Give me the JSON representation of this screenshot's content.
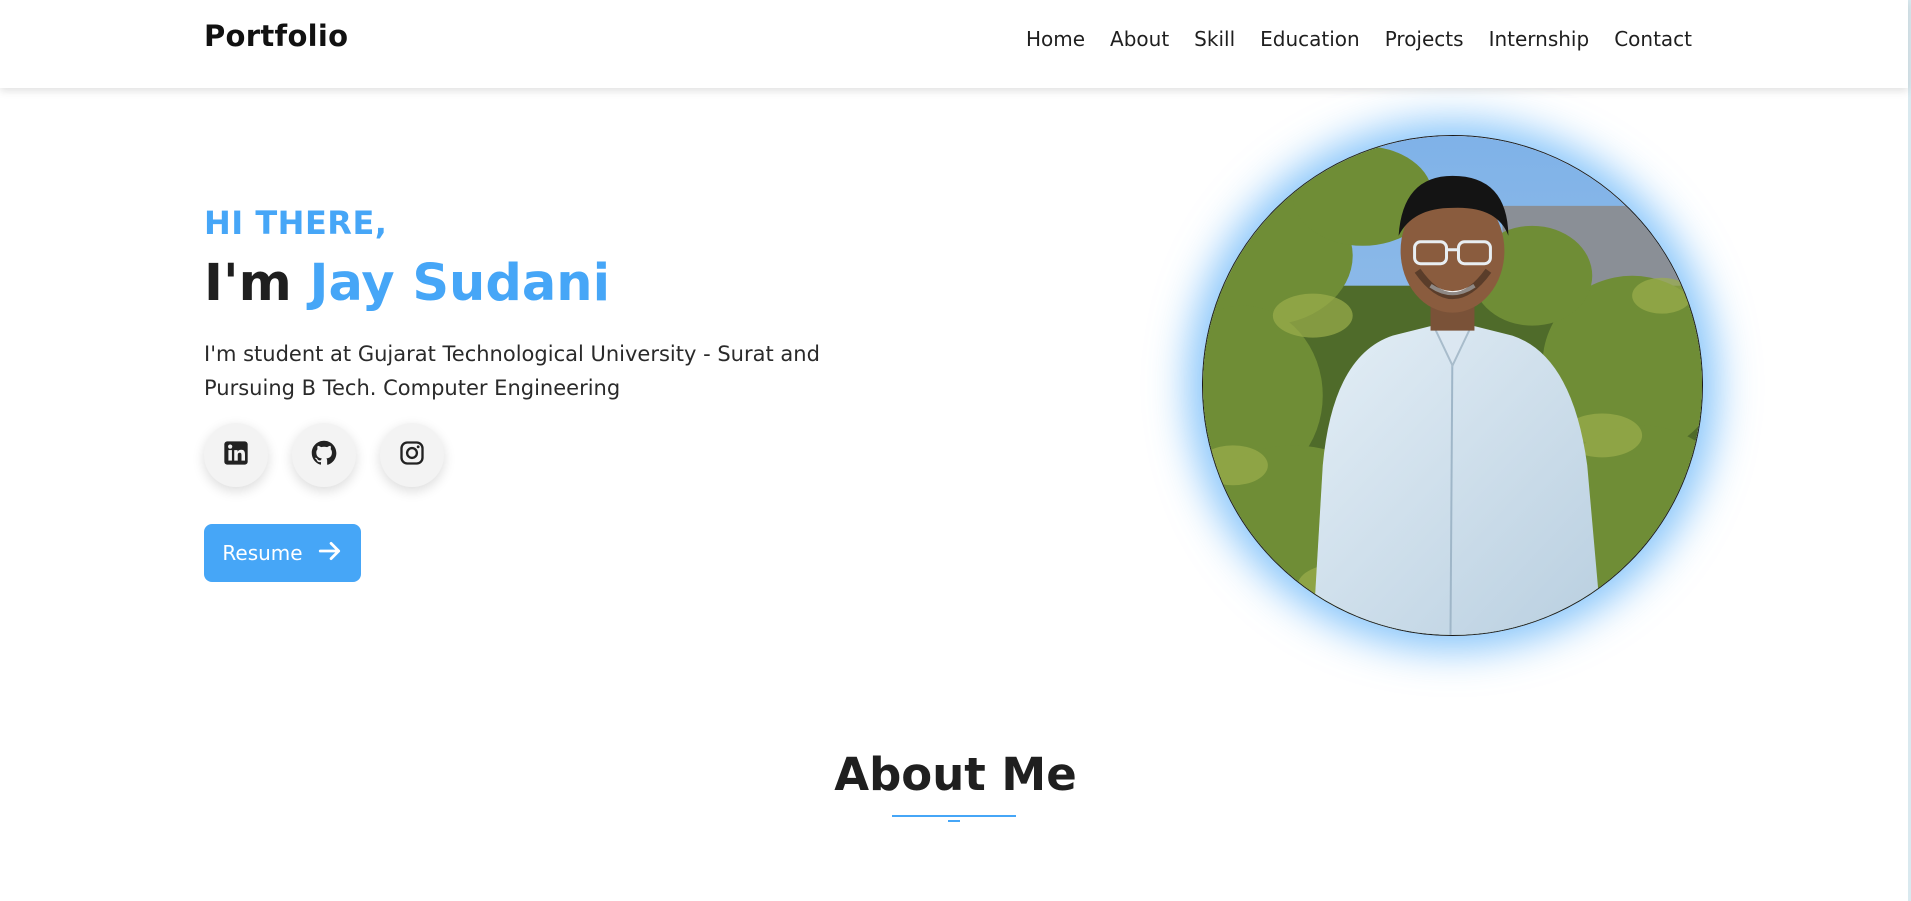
{
  "navbar": {
    "brand": "Portfolio",
    "links": [
      {
        "label": "Home"
      },
      {
        "label": "About"
      },
      {
        "label": "Skill"
      },
      {
        "label": "Education"
      },
      {
        "label": "Projects"
      },
      {
        "label": "Internship"
      },
      {
        "label": "Contact"
      }
    ]
  },
  "hero": {
    "greeting": "HI THERE,",
    "prefix": "I'm ",
    "name": "Jay Sudani",
    "intro": "I'm student at Gujarat Technological University - Surat and Pursuing B Tech. Computer Engineering",
    "socials": [
      {
        "icon": "linkedin-icon"
      },
      {
        "icon": "github-icon"
      },
      {
        "icon": "instagram-icon"
      }
    ],
    "resume_label": "Resume",
    "resume_icon": "arrow-right-icon",
    "photo_icon": "profile-photo"
  },
  "about": {
    "title": "About Me"
  },
  "colors": {
    "accent": "#46a6f7",
    "text": "#1f1f1f",
    "background": "#ffffff"
  }
}
